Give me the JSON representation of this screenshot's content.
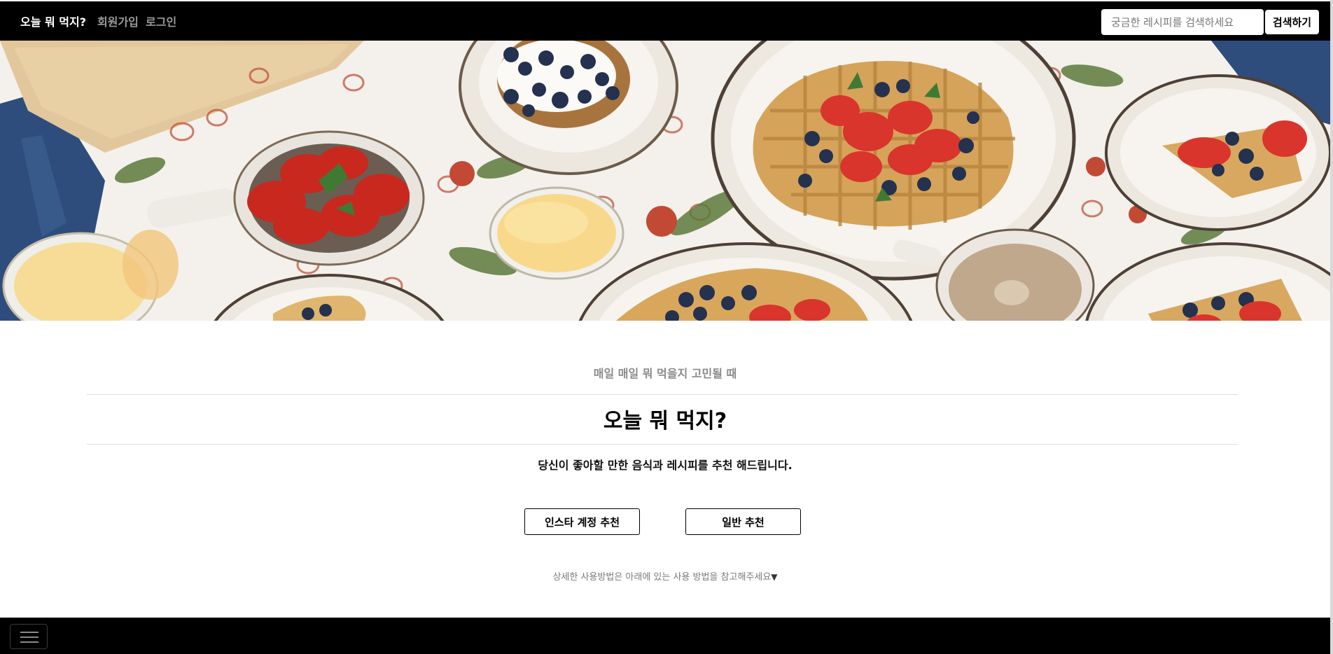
{
  "navbar": {
    "brand": "오늘 뭐 먹지?",
    "links": {
      "signup": "회원가입",
      "login": "로그인"
    },
    "search": {
      "placeholder": "궁금한 레시피를 검색하세요",
      "value": "",
      "button_label": "검색하기"
    }
  },
  "hero": {
    "image": "breakfast-table-waffles-strawberries-blueberries"
  },
  "content": {
    "subtitle": "매일 매일 뭐 먹을지 고민될 때",
    "title": "오늘 뭐 먹지?",
    "description": "당신이 좋아할 만한 음식과 레시피를 추천 해드립니다.",
    "buttons": {
      "insta": "인스타 계정 추천",
      "general": "일반 추천"
    },
    "hint": "상세한 사용방법은 아래에 있는 사용 방법을 참고해주세요",
    "hint_arrow": "▼"
  },
  "footer": {
    "menu_icon": "hamburger-icon"
  },
  "colors": {
    "navbar_bg": "#000000",
    "footer_bg": "#000000",
    "subtitle": "#8a8a8a"
  }
}
